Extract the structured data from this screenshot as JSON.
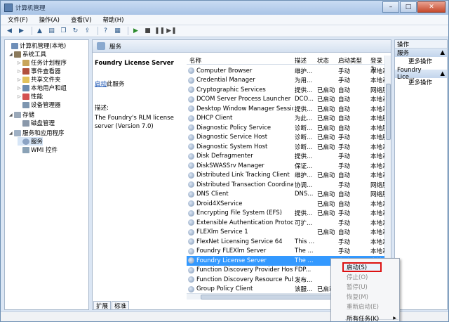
{
  "window": {
    "title": "计算机管理"
  },
  "menubar": [
    "文件(F)",
    "操作(A)",
    "查看(V)",
    "帮助(H)"
  ],
  "tree": {
    "root": "计算机管理(本地)",
    "system_tools": "系统工具",
    "task_scheduler": "任务计划程序",
    "event_viewer": "事件查看器",
    "shared_folders": "共享文件夹",
    "local_users": "本地用户和组",
    "performance": "性能",
    "device_manager": "设备管理器",
    "storage": "存储",
    "disk_management": "磁盘管理",
    "services_apps": "服务和应用程序",
    "services": "服务",
    "wmi": "WMI 控件"
  },
  "center": {
    "header": "服务",
    "desc_title": "Foundry License Server",
    "start_link": "启动",
    "start_suffix": "此服务",
    "desc_label": "描述:",
    "desc_text": "The Foundry's RLM license server (Version 7.0)",
    "tabs": [
      "扩展",
      "标准"
    ]
  },
  "grid": {
    "headers": [
      "名称",
      "描述",
      "状态",
      "启动类型",
      "登录为"
    ],
    "rows": [
      [
        "Computer Browser",
        "维护...",
        "",
        "手动",
        "本地系"
      ],
      [
        "Credential Manager",
        "为用...",
        "",
        "手动",
        "本地系"
      ],
      [
        "Cryptographic Services",
        "提供...",
        "已启动",
        "自动",
        "网络服"
      ],
      [
        "DCOM Server Process Launcher",
        "DCO...",
        "已启动",
        "自动",
        "本地系"
      ],
      [
        "Desktop Window Manager Sessio...",
        "提供...",
        "已启动",
        "自动",
        "本地系"
      ],
      [
        "DHCP Client",
        "为此...",
        "已启动",
        "自动",
        "本地服"
      ],
      [
        "Diagnostic Policy Service",
        "诊断...",
        "已启动",
        "自动",
        "本地服"
      ],
      [
        "Diagnostic Service Host",
        "诊断...",
        "已启动",
        "手动",
        "本地服"
      ],
      [
        "Diagnostic System Host",
        "诊断...",
        "已启动",
        "手动",
        "本地系"
      ],
      [
        "Disk Defragmenter",
        "提供...",
        "",
        "手动",
        "本地系"
      ],
      [
        "DiskSWASSrv Manager",
        "保证...",
        "",
        "手动",
        "本地系"
      ],
      [
        "Distributed Link Tracking Client",
        "维护...",
        "已启动",
        "自动",
        "本地系"
      ],
      [
        "Distributed Transaction Coordinator",
        "协调...",
        "",
        "手动",
        "网络服"
      ],
      [
        "DNS Client",
        "DNS...",
        "已启动",
        "自动",
        "网络服"
      ],
      [
        "Droid4XService",
        "",
        "已启动",
        "自动",
        "本地系"
      ],
      [
        "Encrypting File System (EFS)",
        "提供...",
        "已启动",
        "手动",
        "本地系"
      ],
      [
        "Extensible Authentication Protocol",
        "可扩...",
        "",
        "手动",
        "本地系"
      ],
      [
        "FLEXlm Service 1",
        "",
        "已启动",
        "自动",
        "本地系"
      ],
      [
        "FlexNet Licensing Service 64",
        "This ...",
        "",
        "手动",
        "本地系"
      ],
      [
        "Foundry FLEXlm Server",
        "The ...",
        "",
        "手动",
        "本地系"
      ],
      [
        "Foundry License Server",
        "The ...",
        "",
        "自动",
        "本地系"
      ],
      [
        "Function Discovery Provider Host",
        "FDP...",
        "",
        "手动",
        "本地服"
      ],
      [
        "Function Discovery Resource Publi...",
        "发布...",
        "",
        "手动",
        "本地服"
      ],
      [
        "Group Policy Client",
        "该服...",
        "已启动",
        "自动",
        "本地系"
      ]
    ]
  },
  "actions": {
    "title": "操作",
    "sec1": "服务",
    "more1": "更多操作",
    "sec2": "Foundry Lice...",
    "more2": "更多操作"
  },
  "context_menu": {
    "start": "启动(S)",
    "stop": "停止(O)",
    "pause": "暂停(U)",
    "resume": "恢复(M)",
    "restart": "重新启动(E)",
    "all_tasks": "所有任务(K)"
  }
}
